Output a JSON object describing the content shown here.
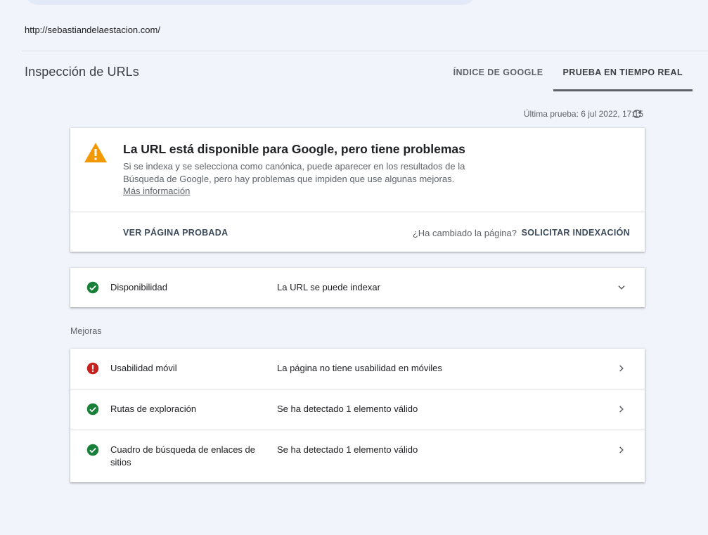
{
  "header": {
    "url": "http://sebastiandelaestacion.com/",
    "page_title": "Inspección de URLs",
    "tabs": [
      {
        "label": "ÍNDICE DE GOOGLE",
        "active": false
      },
      {
        "label": "PRUEBA EN TIEMPO REAL",
        "active": true
      }
    ],
    "last_test": "Última prueba: 6 jul 2022, 17:15"
  },
  "status": {
    "title": "La URL está disponible para Google, pero tiene problemas",
    "description": "Si se indexa y se selecciona como canónica, puede aparecer en los resultados de la Búsqueda de Google, pero hay problemas que impiden que use algunas mejoras.",
    "more_link": "Más información",
    "view_tested_label": "VER PÁGINA PROBADA",
    "changed_question": "¿Ha cambiado la página?",
    "request_index_label": "SOLICITAR INDEXACIÓN",
    "warning_color": "#f29900"
  },
  "availability": {
    "label": "Disponibilidad",
    "value": "La URL se puede indexar",
    "status": "ok"
  },
  "enhancements": {
    "section_label": "Mejoras",
    "items": [
      {
        "label": "Usabilidad móvil",
        "value": "La página no tiene usabilidad en móviles",
        "status": "error"
      },
      {
        "label": "Rutas de exploración",
        "value": "Se ha detectado 1 elemento válido",
        "status": "ok"
      },
      {
        "label": "Cuadro de búsqueda de enlaces de sitios",
        "value": "Se ha detectado 1 elemento válido",
        "status": "ok"
      }
    ]
  },
  "colors": {
    "ok": "#188038",
    "error": "#c5221f",
    "background": "#f1f4fb"
  }
}
